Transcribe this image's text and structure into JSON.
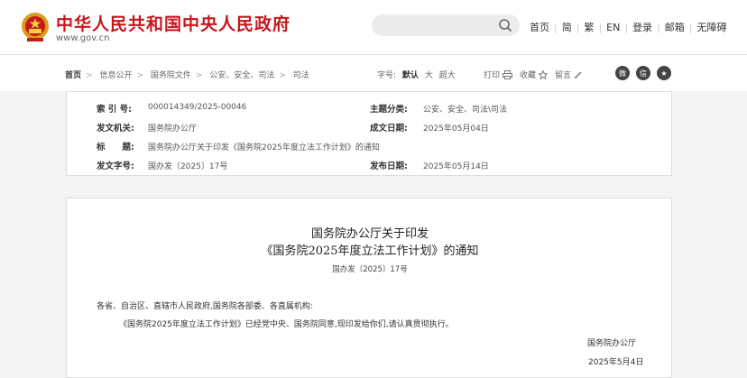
{
  "header": {
    "site_title": "中华人民共和国中央人民政府",
    "site_url": "www.gov.cn",
    "nav": [
      "首页",
      "简",
      "繁",
      "EN",
      "登录",
      "邮箱",
      "无障碍"
    ]
  },
  "breadcrumb": {
    "items": [
      "首页",
      "信息公开",
      "国务院文件",
      "公安、安全、司法",
      "司法"
    ]
  },
  "fontsize": {
    "label": "字号:",
    "options": [
      "默认",
      "大",
      "超大"
    ]
  },
  "tools": {
    "print": "打印",
    "favorite": "收藏",
    "comment": "留言"
  },
  "colors": {
    "brand": "#c8161d"
  },
  "meta": {
    "index_no_label": "索 引 号:",
    "index_no": "000014349/2025-00046",
    "category_label": "主题分类:",
    "category": "公安、安全、司法\\司法",
    "issuer_label": "发文机关:",
    "issuer": "国务院办公厅",
    "created_label": "成文日期:",
    "created": "2025年05月04日",
    "title_label": "标　　题:",
    "title": "国务院办公厅关于印发《国务院2025年度立法工作计划》的通知",
    "doc_no_label": "发文字号:",
    "doc_no": "国办发〔2025〕17号",
    "published_label": "发布日期:",
    "published": "2025年05月14日"
  },
  "document": {
    "title_line1": "国务院办公厅关于印发",
    "title_line2": "《国务院2025年度立法工作计划》的通知",
    "doc_no": "国办发〔2025〕17号",
    "salutation": "各省、自治区、直辖市人民政府,国务院各部委、各直属机构:",
    "body": "《国务院2025年度立法工作计划》已经党中央、国务院同意,现印发给你们,请认真贯彻执行。",
    "signer": "国务院办公厅",
    "date": "2025年5月4日"
  }
}
